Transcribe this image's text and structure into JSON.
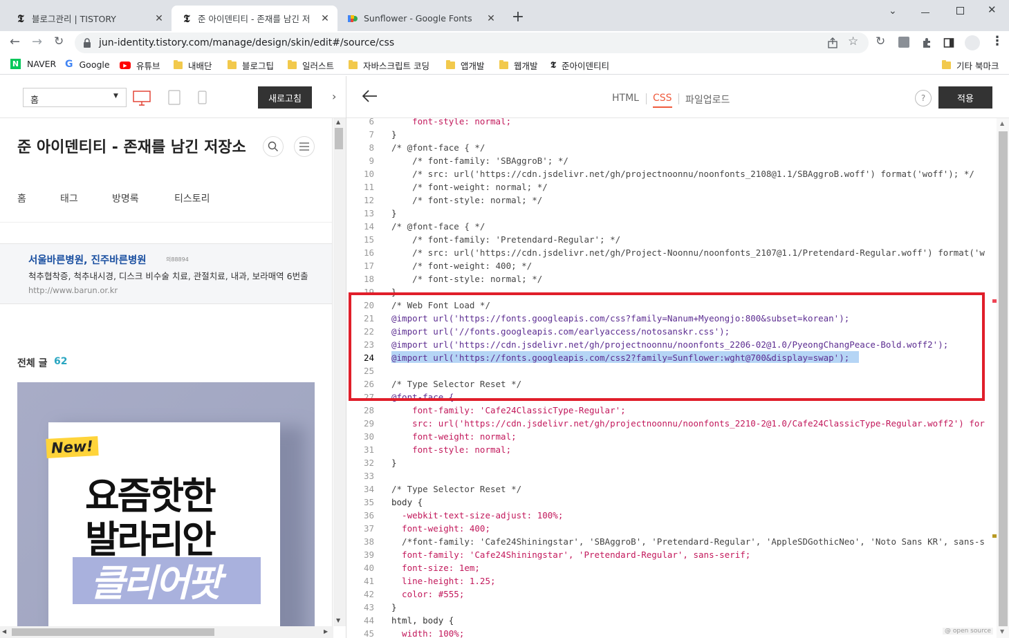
{
  "browser": {
    "tabs": [
      {
        "label": "블로그관리 | TISTORY",
        "active": false
      },
      {
        "label": "준 아이덴티티 - 존재를 남긴 저",
        "active": true
      },
      {
        "label": "Sunflower - Google Fonts",
        "active": false
      }
    ],
    "new_tab": "+",
    "url": "jun-identity.tistory.com/manage/design/skin/edit#/source/css",
    "bookmarks": [
      "NAVER",
      "Google",
      "유튜브",
      "내배단",
      "블로그팁",
      "일러스트",
      "자바스크립트 코딩",
      "앱개발",
      "웹개발",
      "준아이덴티티"
    ],
    "bookmark_other": "기타 북마크"
  },
  "left": {
    "select_value": "홈",
    "refresh_label": "새로고침",
    "blog_title": "준 아이덴티티 - 존재를 남긴 저장소",
    "menu": [
      "홈",
      "태그",
      "방명록",
      "티스토리"
    ],
    "ad": {
      "title": "서울바른병원, 진주바른병원",
      "tag": "의88894",
      "desc": "척추협착증, 척추내시경, 디스크 비수술 치료, 관절치료, 내과, 보라매역 6번출",
      "url": "http://www.barun.or.kr"
    },
    "total_label": "전체 글",
    "total_count": "62",
    "thumb": {
      "badge": "New!",
      "line1": "요즘핫한",
      "line2": "발라리안",
      "line3": "클리어팟"
    }
  },
  "right": {
    "tabs": [
      "HTML",
      "CSS",
      "파일업로드"
    ],
    "active_tab": "CSS",
    "help": "?",
    "apply_label": "적용",
    "watermark": "@ open source"
  },
  "code_lines": [
    {
      "n": "6",
      "t": "    font-style: normal;"
    },
    {
      "n": "7",
      "t": "}"
    },
    {
      "n": "8",
      "t": "/* @font-face { */"
    },
    {
      "n": "9",
      "t": "    /* font-family: 'SBAggroB'; */"
    },
    {
      "n": "10",
      "t": "    /* src: url('https://cdn.jsdelivr.net/gh/projectnoonnu/noonfonts_2108@1.1/SBAggroB.woff') format('woff'); */"
    },
    {
      "n": "11",
      "t": "    /* font-weight: normal; */"
    },
    {
      "n": "12",
      "t": "    /* font-style: normal; */"
    },
    {
      "n": "13",
      "t": "}"
    },
    {
      "n": "14",
      "t": "/* @font-face { */"
    },
    {
      "n": "15",
      "t": "    /* font-family: 'Pretendard-Regular'; */"
    },
    {
      "n": "16",
      "t": "    /* src: url('https://cdn.jsdelivr.net/gh/Project-Noonnu/noonfonts_2107@1.1/Pretendard-Regular.woff') format('w"
    },
    {
      "n": "17",
      "t": "    /* font-weight: 400; */"
    },
    {
      "n": "18",
      "t": "    /* font-style: normal; */"
    },
    {
      "n": "19",
      "t": "}"
    },
    {
      "n": "20",
      "t": "/* Web Font Load */"
    },
    {
      "n": "21",
      "t": "@import url('https://fonts.googleapis.com/css?family=Nanum+Myeongjo:800&subset=korean');"
    },
    {
      "n": "22",
      "t": "@import url('//fonts.googleapis.com/earlyaccess/notosanskr.css');"
    },
    {
      "n": "23",
      "t": "@import url('https://cdn.jsdelivr.net/gh/projectnoonnu/noonfonts_2206-02@1.0/PyeongChangPeace-Bold.woff2');"
    },
    {
      "n": "24",
      "t": "@import url('https://fonts.googleapis.com/css2?family=Sunflower:wght@700&display=swap');"
    },
    {
      "n": "25",
      "t": ""
    },
    {
      "n": "26",
      "t": "/* Type Selector Reset */"
    },
    {
      "n": "27",
      "t": "@font-face {"
    },
    {
      "n": "28",
      "t": "    font-family: 'Cafe24ClassicType-Regular';"
    },
    {
      "n": "29",
      "t": "    src: url('https://cdn.jsdelivr.net/gh/projectnoonnu/noonfonts_2210-2@1.0/Cafe24ClassicType-Regular.woff2') for"
    },
    {
      "n": "30",
      "t": "    font-weight: normal;"
    },
    {
      "n": "31",
      "t": "    font-style: normal;"
    },
    {
      "n": "32",
      "t": "}"
    },
    {
      "n": "33",
      "t": ""
    },
    {
      "n": "34",
      "t": "/* Type Selector Reset */"
    },
    {
      "n": "35",
      "t": "body {"
    },
    {
      "n": "36",
      "t": "  -webkit-text-size-adjust: 100%;"
    },
    {
      "n": "37",
      "t": "  font-weight: 400;"
    },
    {
      "n": "38",
      "t": "  /*font-family: 'Cafe24Shiningstar', 'SBAggroB', 'Pretendard-Regular', 'AppleSDGothicNeo', 'Noto Sans KR', sans-s"
    },
    {
      "n": "39",
      "t": "  font-family: 'Cafe24Shiningstar', 'Pretendard-Regular', sans-serif;"
    },
    {
      "n": "40",
      "t": "  font-size: 1em;"
    },
    {
      "n": "41",
      "t": "  line-height: 1.25;"
    },
    {
      "n": "42",
      "t": "  color: #555;"
    },
    {
      "n": "43",
      "t": "}"
    },
    {
      "n": "44",
      "t": "html, body {"
    },
    {
      "n": "45",
      "t": "  width: 100%;"
    }
  ],
  "colors": {
    "accent": "#ef5a3c",
    "highlight_box": "#e01e2a",
    "selection": "#b5d5f5",
    "apply_bg": "#333333"
  }
}
